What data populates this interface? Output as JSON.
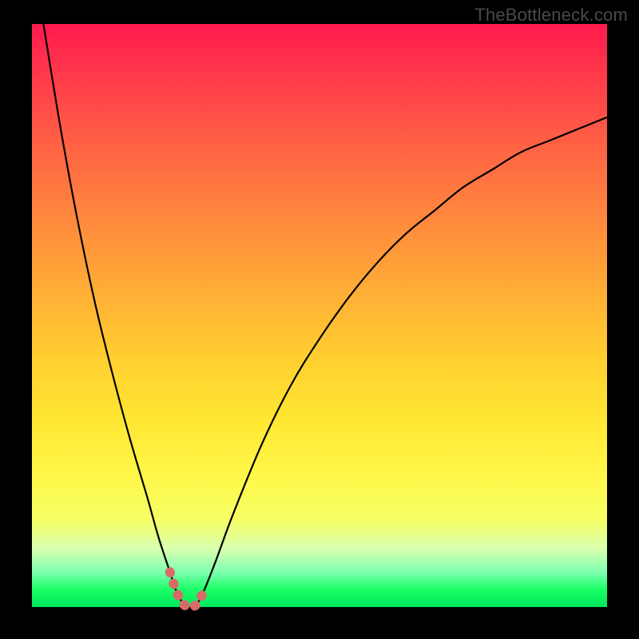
{
  "watermark": "TheBottleneck.com",
  "chart_data": {
    "type": "line",
    "title": "",
    "xlabel": "",
    "ylabel": "",
    "xlim": [
      0,
      100
    ],
    "ylim": [
      0,
      100
    ],
    "grid": false,
    "series": [
      {
        "name": "curve",
        "color": "#000000",
        "x": [
          2,
          5,
          8,
          11,
          14,
          17,
          20,
          22,
          24,
          25,
          26,
          27,
          28,
          29,
          30,
          32,
          35,
          40,
          45,
          50,
          55,
          60,
          65,
          70,
          75,
          80,
          85,
          90,
          95,
          100
        ],
        "values": [
          100,
          82,
          66,
          52,
          40,
          29,
          19,
          12,
          6,
          3,
          1,
          0,
          0,
          1,
          3,
          8,
          16,
          28,
          38,
          46,
          53,
          59,
          64,
          68,
          72,
          75,
          78,
          80,
          82,
          84
        ]
      },
      {
        "name": "highlight",
        "color": "#d96a6a",
        "x": [
          24,
          25,
          26,
          27,
          28,
          29,
          30
        ],
        "values": [
          6,
          3,
          1,
          0,
          0,
          1,
          3
        ]
      }
    ]
  }
}
